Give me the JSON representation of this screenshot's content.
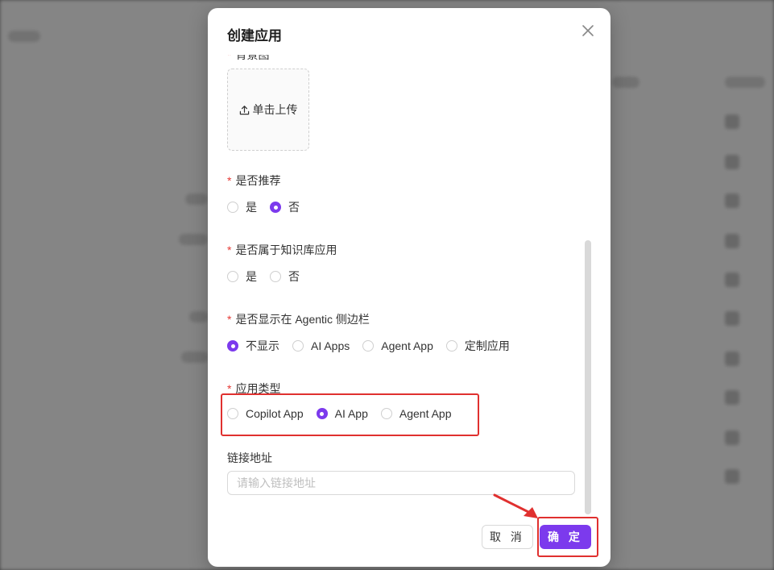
{
  "modal": {
    "title": "创建应用",
    "background_image": {
      "label": "背景图",
      "upload_label": "单击上传"
    },
    "recommend": {
      "label": "是否推荐",
      "options": [
        "是",
        "否"
      ],
      "selected": "否"
    },
    "knowledge_base": {
      "label": "是否属于知识库应用",
      "options": [
        "是",
        "否"
      ],
      "selected": null
    },
    "agentic_sidebar": {
      "label": "是否显示在 Agentic 侧边栏",
      "options": [
        "不显示",
        "AI Apps",
        "Agent App",
        "定制应用"
      ],
      "selected": "不显示"
    },
    "app_type": {
      "label": "应用类型",
      "options": [
        "Copilot App",
        "AI App",
        "Agent App"
      ],
      "selected": "AI App"
    },
    "link": {
      "label": "链接地址",
      "placeholder": "请输入链接地址",
      "value": ""
    },
    "cancel_label": "取 消",
    "confirm_label": "确 定"
  },
  "colors": {
    "accent": "#7c3aed",
    "required": "#e53935",
    "highlight": "#e0302f"
  },
  "icons": {
    "close": "close-icon",
    "upload": "upload-icon"
  }
}
